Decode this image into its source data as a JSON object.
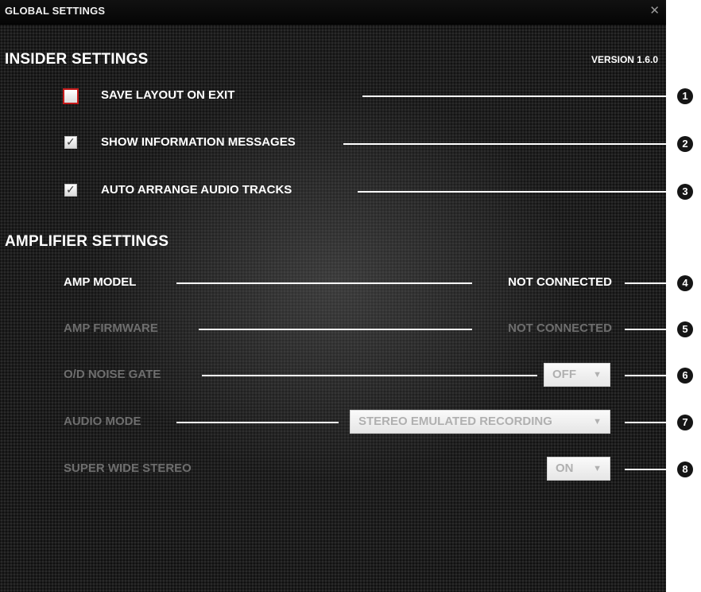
{
  "window": {
    "title": "GLOBAL SETTINGS",
    "close_glyph": "✕"
  },
  "insider": {
    "title": "INSIDER SETTINGS",
    "version": "VERSION 1.6.0",
    "options": [
      {
        "label": "SAVE LAYOUT ON EXIT",
        "checked": false,
        "callout": "1"
      },
      {
        "label": "SHOW INFORMATION MESSAGES",
        "checked": true,
        "callout": "2"
      },
      {
        "label": "AUTO ARRANGE AUDIO TRACKS",
        "checked": true,
        "callout": "3"
      }
    ]
  },
  "amplifier": {
    "title": "AMPLIFIER SETTINGS",
    "amp_model": {
      "label": "AMP MODEL",
      "value": "NOT CONNECTED",
      "callout": "4"
    },
    "amp_firmware": {
      "label": "AMP FIRMWARE",
      "value": "NOT CONNECTED",
      "callout": "5"
    },
    "noise_gate": {
      "label": "O/D NOISE GATE",
      "selected": "OFF",
      "callout": "6"
    },
    "audio_mode": {
      "label": "AUDIO MODE",
      "selected": "STEREO EMULATED RECORDING",
      "callout": "7"
    },
    "super_wide": {
      "label": "SUPER WIDE STEREO",
      "selected": "ON",
      "callout": "8"
    }
  },
  "icons": {
    "check": "✓",
    "dropdown_arrow": "▼",
    "callout_numbers": [
      "1",
      "2",
      "3",
      "4",
      "5",
      "6",
      "7",
      "8"
    ]
  },
  "colors": {
    "background": "#1c1c1c",
    "text": "#ffffff",
    "disabled_text": "#6e6e6e",
    "focus_border": "#c41a1a",
    "dropdown_bg": "#f2f2f2"
  }
}
